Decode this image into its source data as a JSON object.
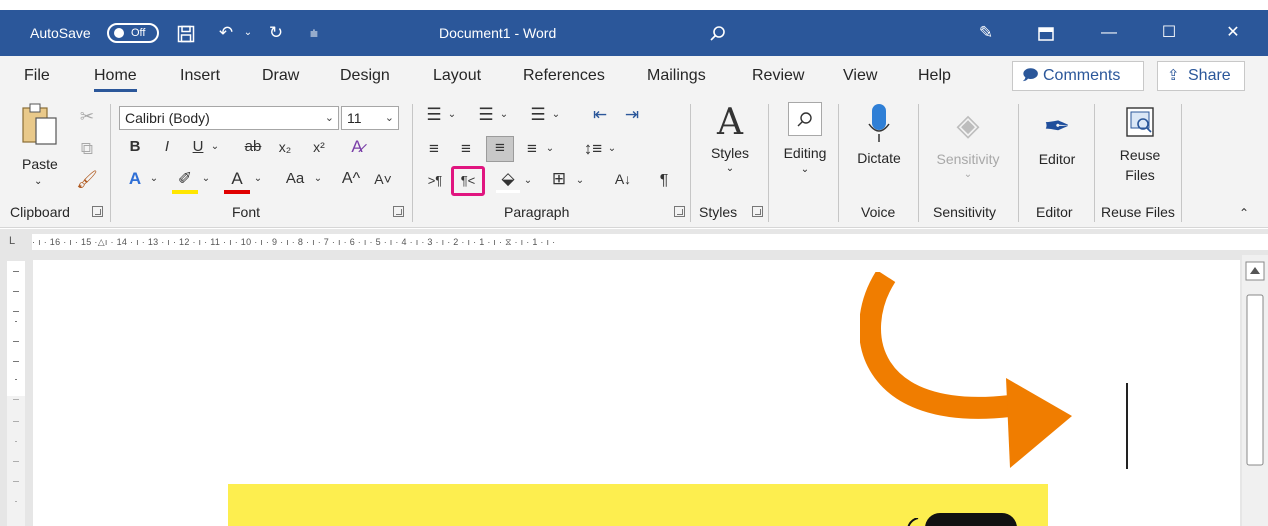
{
  "titlebar": {
    "autosave_label": "AutoSave",
    "autosave_state": "Off",
    "document_title": "Document1  -  Word"
  },
  "tabs": [
    {
      "label": "File"
    },
    {
      "label": "Home"
    },
    {
      "label": "Insert"
    },
    {
      "label": "Draw"
    },
    {
      "label": "Design"
    },
    {
      "label": "Layout"
    },
    {
      "label": "References"
    },
    {
      "label": "Mailings"
    },
    {
      "label": "Review"
    },
    {
      "label": "View"
    },
    {
      "label": "Help"
    }
  ],
  "header_buttons": {
    "comments": "Comments",
    "share": "Share"
  },
  "ribbon": {
    "clipboard": {
      "paste": "Paste",
      "group": "Clipboard"
    },
    "font": {
      "name": "Calibri (Body)",
      "size": "11",
      "group": "Font",
      "bold": "B",
      "italic": "I",
      "underline": "U",
      "strike": "ab",
      "sub": "x₂",
      "sup": "x²",
      "case": "Aa",
      "grow": "A^",
      "shrink": "A˅"
    },
    "paragraph": {
      "group": "Paragraph",
      "ltr": ">¶",
      "rtl": "¶<",
      "pilcrow": "¶"
    },
    "styles": {
      "label": "Styles",
      "group": "Styles"
    },
    "editing": {
      "label": "Editing"
    },
    "voice": {
      "dictate": "Dictate",
      "group": "Voice"
    },
    "sensitivity": {
      "label": "Sensitivity",
      "group": "Sensitivity"
    },
    "editor": {
      "label": "Editor",
      "group": "Editor"
    },
    "reuse": {
      "label_line1": "Reuse",
      "label_line2": "Files",
      "group": "Reuse Files"
    }
  },
  "ruler": {
    "corner": "L",
    "ticks": "· ı · 16 · ı · 15 ·△ı · 14 · ı · 13 · ı · 12 · ı · 11 · ı · 10 · ı · 9 · ı · 8 · ı · 7 · ı · 6 · ı · 5 · ı · 4 · ı · 3 · ı · 2 · ı · 1 · ı · ⧖ · ı · 1 · ı ·"
  },
  "colors": {
    "title_bar": "#2b579a",
    "highlight_box": "#e0157f",
    "arrow": "#f07d00",
    "note_box": "#fdee4f"
  }
}
